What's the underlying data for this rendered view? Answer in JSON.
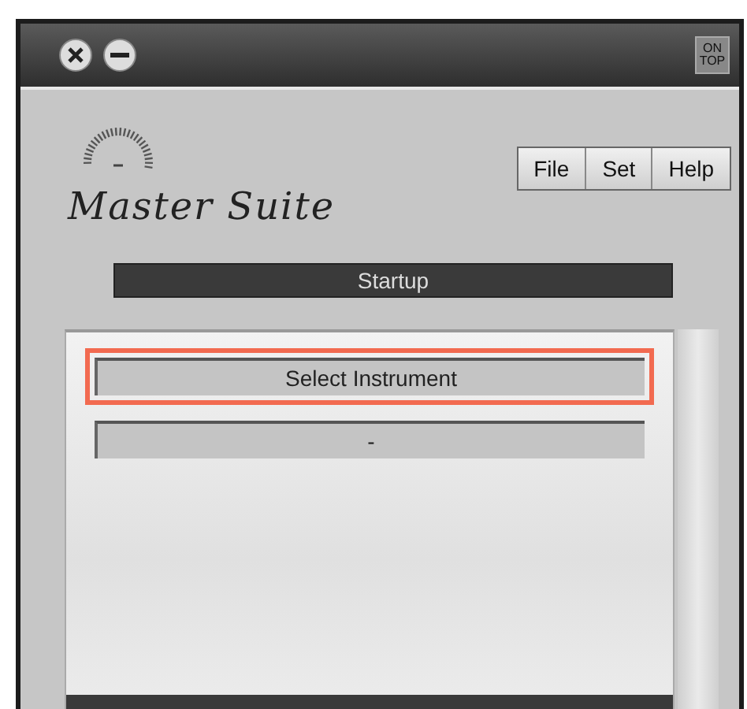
{
  "titlebar": {
    "on_top_label": [
      "ON",
      "TOP"
    ]
  },
  "logo": {
    "title": "Master Suite"
  },
  "menu": [
    {
      "label": "File"
    },
    {
      "label": "Set"
    },
    {
      "label": "Help"
    }
  ],
  "status": "Startup",
  "list": [
    {
      "label": "Select Instrument",
      "selected": true
    },
    {
      "label": "-",
      "selected": false
    }
  ]
}
